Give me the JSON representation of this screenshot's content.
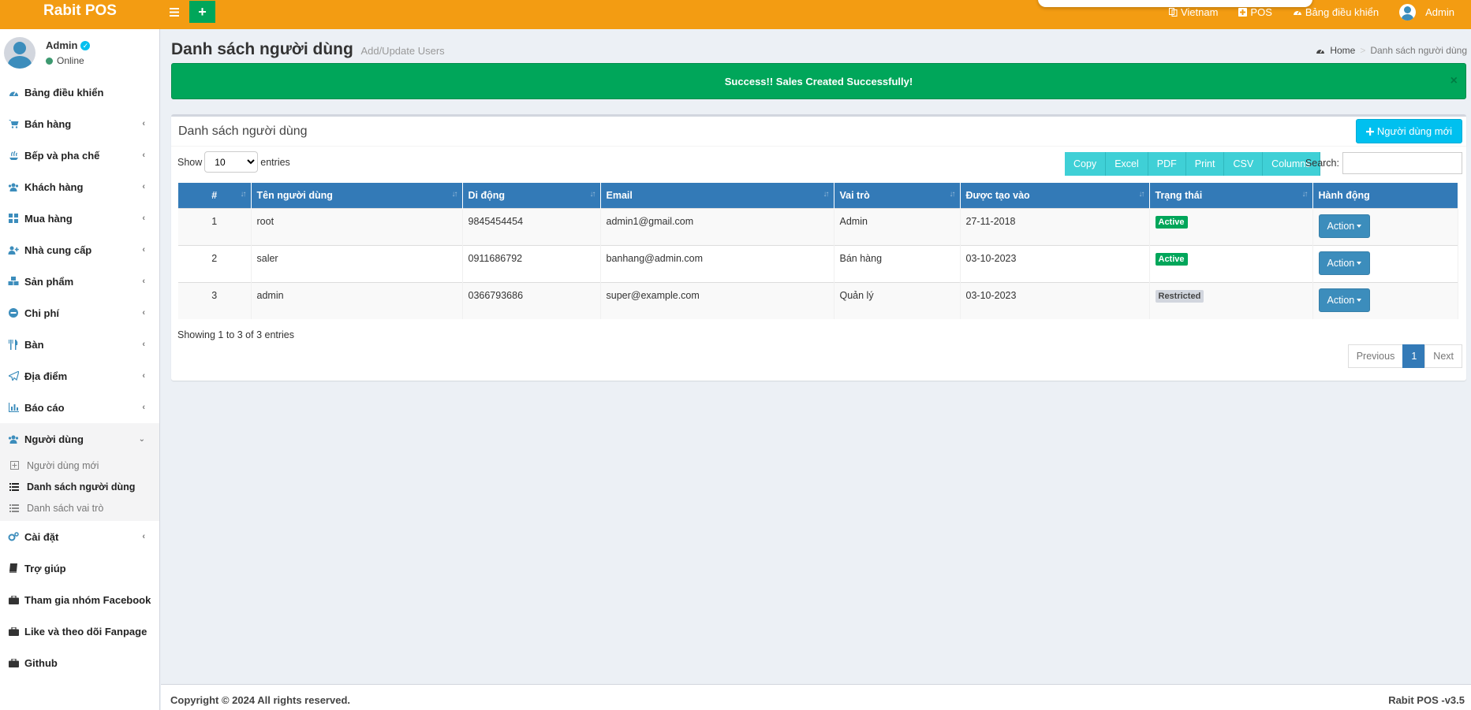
{
  "header": {
    "logo": "Rabit POS",
    "nav": {
      "language": "Vietnam",
      "pos": "POS",
      "dashboard": "Bảng điều khiển",
      "user": "Admin"
    }
  },
  "sidebar": {
    "user": {
      "name": "Admin",
      "status": "Online"
    },
    "items": [
      {
        "label": "Bảng điều khiển",
        "icon": "dashboard-icon"
      },
      {
        "label": "Bán hàng",
        "icon": "cart-icon"
      },
      {
        "label": "Bếp và pha chế",
        "icon": "kitchen-icon"
      },
      {
        "label": "Khách hàng",
        "icon": "users-icon"
      },
      {
        "label": "Mua hàng",
        "icon": "grid-icon"
      },
      {
        "label": "Nhà cung cấp",
        "icon": "user-plus-icon"
      },
      {
        "label": "Sản phẩm",
        "icon": "cubes-icon"
      },
      {
        "label": "Chi phí",
        "icon": "minus-circle-icon"
      },
      {
        "label": "Bàn",
        "icon": "cutlery-icon"
      },
      {
        "label": "Địa điểm",
        "icon": "paper-plane-icon"
      },
      {
        "label": "Báo cáo",
        "icon": "bar-chart-icon"
      },
      {
        "label": "Người dùng",
        "icon": "users-icon"
      },
      {
        "label": "Cài đặt",
        "icon": "cogs-icon"
      },
      {
        "label": "Trợ giúp",
        "icon": "book-icon"
      },
      {
        "label": "Tham gia nhóm Facebook",
        "icon": "briefcase-icon"
      },
      {
        "label": "Like và theo dõi Fanpage",
        "icon": "briefcase-icon"
      },
      {
        "label": "Github",
        "icon": "briefcase-icon"
      }
    ],
    "users_submenu": [
      {
        "label": "Người dùng mới",
        "icon": "plus-square-icon"
      },
      {
        "label": "Danh sách người dùng",
        "icon": "list-icon"
      },
      {
        "label": "Danh sách vai trò",
        "icon": "list-icon"
      }
    ]
  },
  "content": {
    "title": "Danh sách người dùng",
    "subtitle": "Add/Update Users",
    "breadcrumb": {
      "home": "Home",
      "current": "Danh sách người dùng"
    },
    "alert": "Success!! Sales Created Successfully!",
    "alert_close": "×",
    "box_title": "Danh sách người dùng",
    "new_user_button": "Người dùng mới",
    "show_label": "Show",
    "entries_label": "entries",
    "entries_value": "10",
    "export_buttons": [
      "Copy",
      "Excel",
      "PDF",
      "Print",
      "CSV",
      "Columns"
    ],
    "search_label": "Search:",
    "columns": [
      "#",
      "Tên người dùng",
      "Di động",
      "Email",
      "Vai trò",
      "Được tạo vào",
      "Trạng thái",
      "Hành động"
    ],
    "rows": [
      {
        "no": "1",
        "username": "root",
        "mobile": "9845454454",
        "email": "admin1@gmail.com",
        "role": "Admin",
        "created": "27-11-2018",
        "status": "Active",
        "action": "Action"
      },
      {
        "no": "2",
        "username": "saler",
        "mobile": "0911686792",
        "email": "banhang@admin.com",
        "role": "Bán hàng",
        "created": "03-10-2023",
        "status": "Active",
        "action": "Action"
      },
      {
        "no": "3",
        "username": "admin",
        "mobile": "0366793686",
        "email": "super@example.com",
        "role": "Quản lý",
        "created": "03-10-2023",
        "status": "Restricted",
        "action": "Action"
      }
    ],
    "showing_info": "Showing 1 to 3 of 3 entries",
    "pagination": {
      "previous": "Previous",
      "page": "1",
      "next": "Next"
    }
  },
  "footer": {
    "copyright": "Copyright © 2024 All rights reserved.",
    "version": "Rabit POS -v3.5"
  },
  "colors": {
    "header": "#f39c12",
    "primary": "#337ab7",
    "success": "#00a65a",
    "info": "#00c0ef",
    "export": "#3fd0d6"
  }
}
